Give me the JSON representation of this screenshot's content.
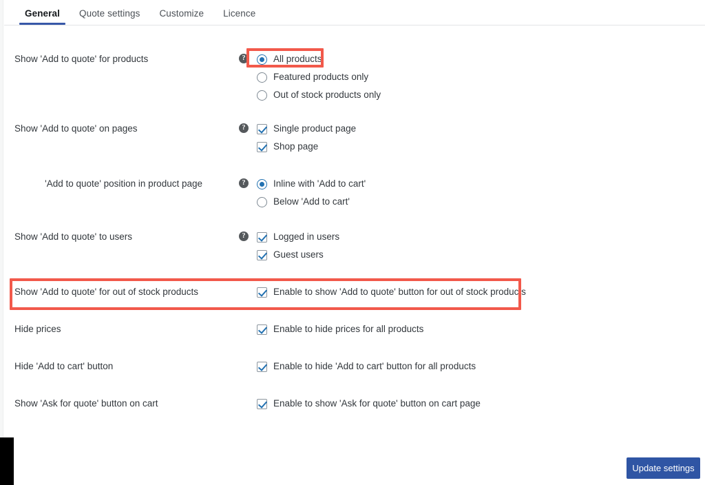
{
  "colors": {
    "accent_blue": "#2271b1",
    "tab_underline": "#3858a8",
    "highlight_red": "#f2594b",
    "button_blue": "#2f55a4"
  },
  "tabs": [
    {
      "label": "General",
      "active": true
    },
    {
      "label": "Quote settings",
      "active": false
    },
    {
      "label": "Customize",
      "active": false
    },
    {
      "label": "Licence",
      "active": false
    }
  ],
  "help_icon": "question-mark-icon",
  "rows": [
    {
      "label": "Show 'Add to quote' for products",
      "has_help": true,
      "options": [
        {
          "type": "radio",
          "text": "All products",
          "checked": true
        },
        {
          "type": "radio",
          "text": "Featured products only",
          "checked": false
        },
        {
          "type": "radio",
          "text": "Out of stock products only",
          "checked": false
        }
      ]
    },
    {
      "label": "Show 'Add to quote' on pages",
      "has_help": true,
      "options": [
        {
          "type": "checkbox",
          "text": "Single product page",
          "checked": true
        },
        {
          "type": "checkbox",
          "text": "Shop page",
          "checked": true
        }
      ]
    },
    {
      "label": "'Add to quote' position in product page",
      "has_help": true,
      "options": [
        {
          "type": "radio",
          "text": "Inline with 'Add to cart'",
          "checked": true
        },
        {
          "type": "radio",
          "text": "Below 'Add to cart'",
          "checked": false
        }
      ]
    },
    {
      "label": "Show 'Add to quote' to users",
      "has_help": true,
      "options": [
        {
          "type": "checkbox",
          "text": "Logged in users",
          "checked": true
        },
        {
          "type": "checkbox",
          "text": "Guest users",
          "checked": true
        }
      ]
    },
    {
      "label": "Show 'Add to quote' for out of stock products",
      "has_help": false,
      "options": [
        {
          "type": "checkbox",
          "text": "Enable to show 'Add to quote' button for out of stock products",
          "checked": true
        }
      ]
    },
    {
      "label": "Hide prices",
      "has_help": false,
      "options": [
        {
          "type": "checkbox",
          "text": "Enable to hide prices for all products",
          "checked": true
        }
      ]
    },
    {
      "label": "Hide 'Add to cart' button",
      "has_help": false,
      "options": [
        {
          "type": "checkbox",
          "text": "Enable to hide 'Add to cart' button for all products",
          "checked": true
        }
      ]
    },
    {
      "label": "Show 'Ask for quote' button on cart",
      "has_help": false,
      "options": [
        {
          "type": "checkbox",
          "text": "Enable to show 'Ask for quote' button on cart page",
          "checked": true
        }
      ]
    }
  ],
  "footer": {
    "update_label": "Update settings"
  }
}
